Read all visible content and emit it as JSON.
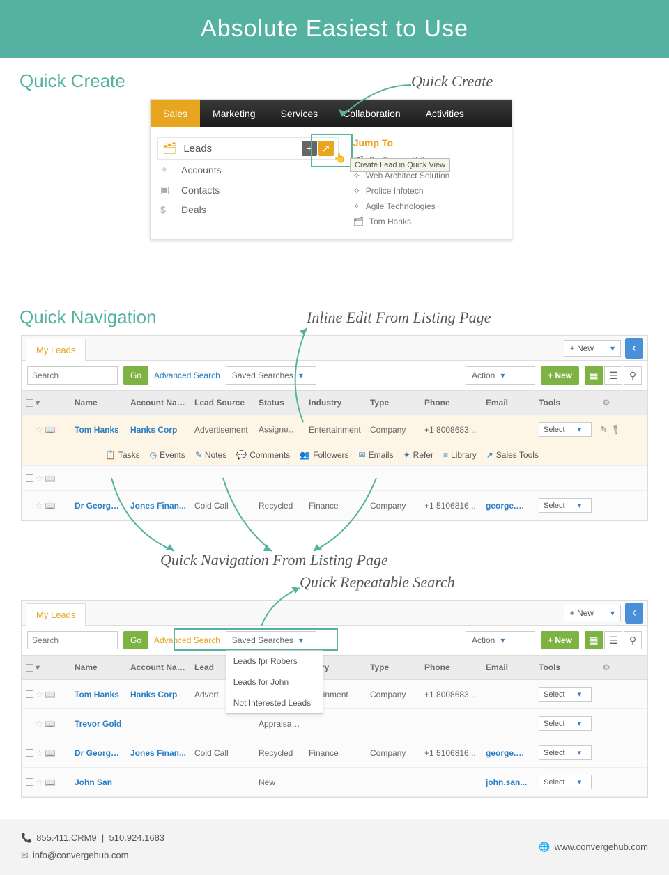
{
  "banner": "Absolute Easiest to Use",
  "sections": {
    "quick_create": "Quick Create",
    "quick_nav": "Quick Navigation"
  },
  "annotations": {
    "quick_create": "Quick Create",
    "inline_edit": "Inline Edit From Listing Page",
    "quick_nav_listing": "Quick Navigation From Listing Page",
    "repeatable_search": "Quick Repeatable Search"
  },
  "nav": {
    "items": [
      "Sales",
      "Marketing",
      "Services",
      "Collaboration",
      "Activities"
    ]
  },
  "qc_left": {
    "leads": "Leads",
    "accounts": "Accounts",
    "contacts": "Contacts",
    "deals": "Deals"
  },
  "qc_tooltip": "Create Lead in Quick View",
  "jump": {
    "header": "Jump To",
    "items": [
      "Dr. George Wilson",
      "Web Architect Solution",
      "Prolice Infotech",
      "Agile Technologies",
      "Tom Hanks"
    ]
  },
  "listing": {
    "tab": "My Leads",
    "new_dd": "+ New",
    "search_placeholder": "Search",
    "go": "Go",
    "adv": "Advanced Search",
    "saved": "Saved Searches",
    "action": "Action",
    "new_btn": "+ New",
    "columns": [
      "Name",
      "Account Name",
      "Lead Source",
      "Status",
      "Industry",
      "Type",
      "Phone",
      "Email",
      "Tools"
    ],
    "select": "Select"
  },
  "subtools": [
    "Tasks",
    "Events",
    "Notes",
    "Comments",
    "Followers",
    "Emails",
    "Refer",
    "Library",
    "Sales Tools"
  ],
  "rows1": [
    {
      "name": "Tom Hanks",
      "acct": "Hanks Corp",
      "src": "Advertisement",
      "status": "Assigned",
      "ind": "Entertainment",
      "type": "Company",
      "phone": "+1 8008683...",
      "email": "",
      "gold": false,
      "hl": true
    },
    {
      "name": "",
      "acct": "",
      "src": "",
      "status": "",
      "ind": "",
      "type": "",
      "phone": "",
      "email": "",
      "gold": false,
      "hl": false,
      "blank": true
    },
    {
      "name": "Dr George...",
      "acct": "Jones Finan...",
      "src": "Cold Call",
      "status": "Recycled",
      "ind": "Finance",
      "type": "Company",
      "phone": "+1 5106816...",
      "email": "george.wi...",
      "gold": true
    }
  ],
  "saved_menu": [
    "Leads fpr Robers",
    "Leads for John",
    "Not Interested Leads"
  ],
  "rows2": [
    {
      "name": "Tom Hanks",
      "acct": "Hanks Corp",
      "src": "Advert",
      "status": "",
      "ind": "ertainment",
      "type": "Company",
      "phone": "+1 8008683...",
      "email": ""
    },
    {
      "name": "Trevor Gold",
      "acct": "",
      "src": "",
      "status": "Appraisal Re...",
      "ind": "",
      "type": "",
      "phone": "",
      "email": ""
    },
    {
      "name": "Dr George...",
      "acct": "Jones Finan...",
      "src": "Cold Call",
      "status": "Recycled",
      "ind": "Finance",
      "type": "Company",
      "phone": "+1 5106816...",
      "email": "george.wi...",
      "gold": true
    },
    {
      "name": "John San",
      "acct": "",
      "src": "",
      "status": "New",
      "ind": "",
      "type": "",
      "phone": "",
      "email": "john.san..."
    }
  ],
  "footer": {
    "phone1": "855.411.CRM9",
    "phone2": "510.924.1683",
    "email": "info@convergehub.com",
    "site": "www.convergehub.com"
  }
}
